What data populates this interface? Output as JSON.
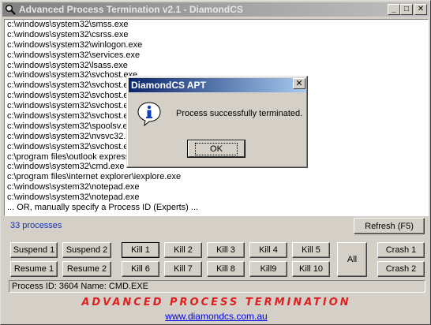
{
  "window": {
    "title": "Advanced Process Termination v2.1 - DiamondCS",
    "minimize": "_",
    "maximize": "□",
    "close": "✕"
  },
  "process_list": [
    "c:\\windows\\system32\\smss.exe",
    "c:\\windows\\system32\\csrss.exe",
    "c:\\windows\\system32\\winlogon.exe",
    "c:\\windows\\system32\\services.exe",
    "c:\\windows\\system32\\lsass.exe",
    "c:\\windows\\system32\\svchost.exe",
    "c:\\windows\\system32\\svchost.exe",
    "c:\\windows\\system32\\svchost.exe",
    "c:\\windows\\system32\\svchost.exe",
    "c:\\windows\\system32\\svchost.exe",
    "c:\\windows\\system32\\spoolsv.exe",
    "c:\\windows\\system32\\nvsvc32.exe",
    "c:\\windows\\system32\\svchost.exe",
    "c:\\program files\\outlook express\\msimn.exe",
    "c:\\windows\\system32\\cmd.exe",
    "c:\\program files\\internet explorer\\iexplore.exe",
    "c:\\windows\\system32\\notepad.exe",
    "c:\\windows\\system32\\notepad.exe",
    "... OR, manually specify a Process ID (Experts) ..."
  ],
  "process_count": "33 processes",
  "buttons": {
    "refresh": "Refresh (F5)",
    "suspend1": "Suspend 1",
    "suspend2": "Suspend 2",
    "resume1": "Resume 1",
    "resume2": "Resume 2",
    "kill1": "Kill 1",
    "kill2": "Kill 2",
    "kill3": "Kill 3",
    "kill4": "Kill 4",
    "kill5": "Kill 5",
    "kill6": "Kill 6",
    "kill7": "Kill 7",
    "kill8": "Kill 8",
    "kill9": "Kill9",
    "kill10": "Kill 10",
    "all": "All",
    "crash1": "Crash 1",
    "crash2": "Crash 2"
  },
  "status": "Process ID: 3604   Name: CMD.EXE",
  "brand": "ADVANCED PROCESS TERMINATION",
  "link": "www.diamondcs.com.au",
  "dialog": {
    "title": "DiamondCS APT",
    "close": "✕",
    "message": "Process successfully terminated.",
    "ok": "OK"
  },
  "colors": {
    "count_text": "#1030c0",
    "brand_text": "#e02020",
    "link_text": "#0000ee",
    "dialog_title_start": "#0a246a",
    "window_title_start": "#808080"
  }
}
